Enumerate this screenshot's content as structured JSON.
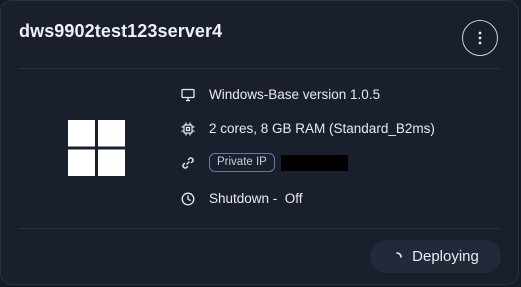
{
  "card": {
    "title": "dws9902test123server4",
    "menu_icon": "more-vertical-icon",
    "os_icon": "windows-logo-icon",
    "details": [
      {
        "icon": "monitor-icon",
        "text": "Windows-Base version 1.0.5"
      },
      {
        "icon": "cpu-chip-icon",
        "text": "2 cores, 8 GB RAM (Standard_B2ms)"
      },
      {
        "icon": "link-icon",
        "badge": "Private IP",
        "redacted": true
      },
      {
        "icon": "clock-icon",
        "text": "Shutdown -  Off"
      }
    ],
    "status_button": {
      "icon": "spinner-icon",
      "label": "Deploying"
    }
  },
  "colors": {
    "background": "#161b28",
    "card": "#1a1f2d",
    "text": "#e8ebf2",
    "border": "#2a3040",
    "button": "#232938"
  }
}
